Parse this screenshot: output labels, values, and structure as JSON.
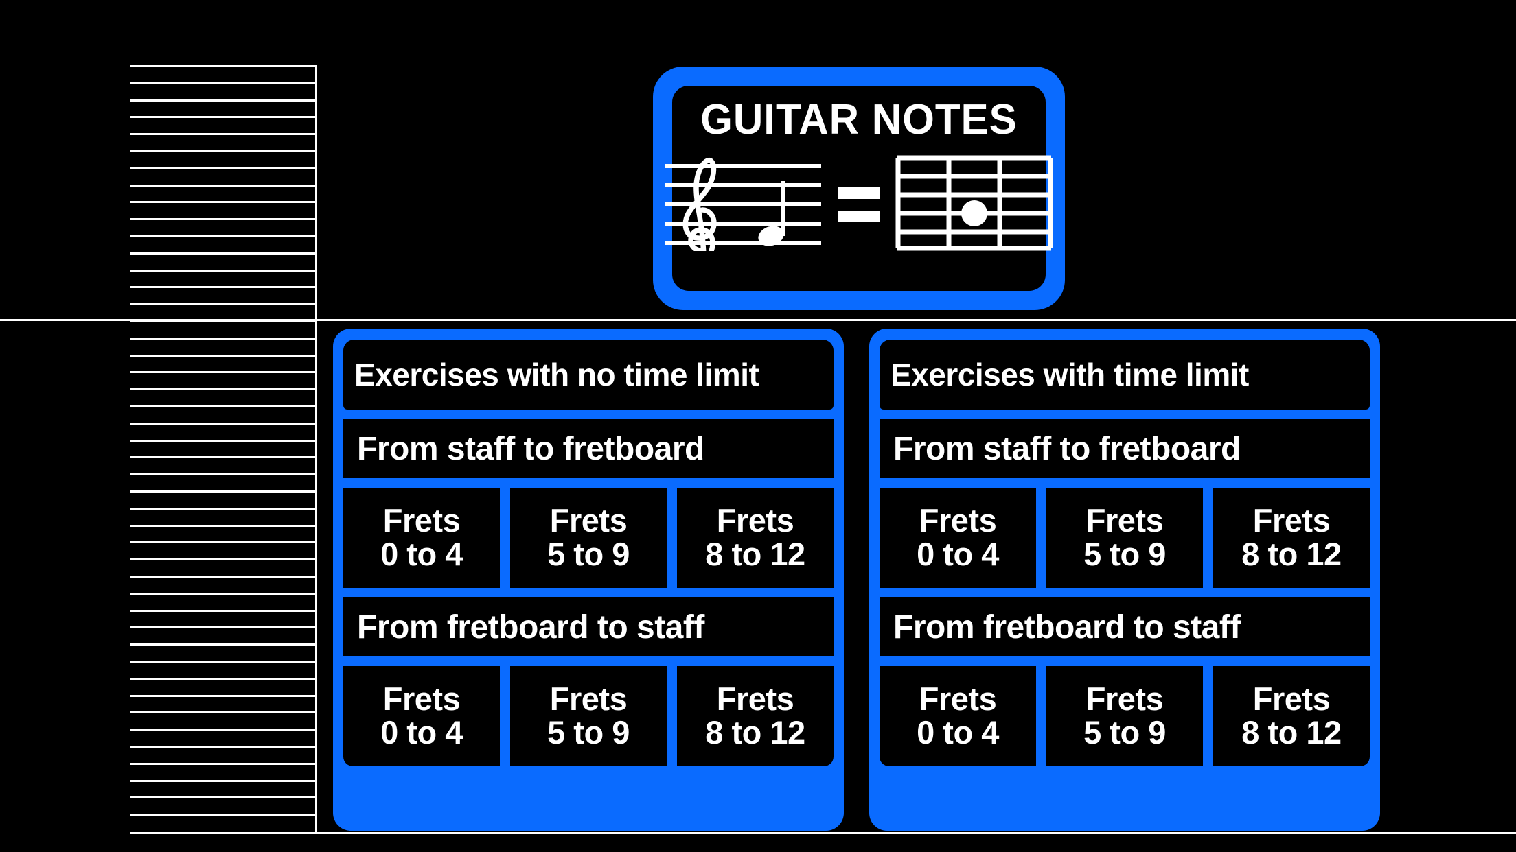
{
  "colors": {
    "accent_blue": "#0A6BFF",
    "background": "#000000",
    "text": "#FFFFFF"
  },
  "logo": {
    "title": "GUITAR NOTES",
    "staff_icon": "treble-clef-staff-icon",
    "equals_icon": "equals-icon",
    "fretboard_icon": "fretboard-diagram-icon",
    "fretboard": {
      "strings": 6,
      "frets": 3,
      "dot_string_index": 3,
      "dot_fret_index": 2
    }
  },
  "panels": [
    {
      "title": "Exercises with no time limit",
      "sections": [
        {
          "label": "From staff to fretboard",
          "buttons": [
            {
              "line1": "Frets",
              "line2": "0 to 4"
            },
            {
              "line1": "Frets",
              "line2": "5 to 9"
            },
            {
              "line1": "Frets",
              "line2": "8 to 12"
            }
          ]
        },
        {
          "label": "From fretboard to staff",
          "buttons": [
            {
              "line1": "Frets",
              "line2": "0 to 4"
            },
            {
              "line1": "Frets",
              "line2": "5 to 9"
            },
            {
              "line1": "Frets",
              "line2": "8 to 12"
            }
          ]
        }
      ]
    },
    {
      "title": "Exercises with time limit",
      "sections": [
        {
          "label": "From staff to fretboard",
          "buttons": [
            {
              "line1": "Frets",
              "line2": "0 to 4"
            },
            {
              "line1": "Frets",
              "line2": "5 to 9"
            },
            {
              "line1": "Frets",
              "line2": "8 to 12"
            }
          ]
        },
        {
          "label": "From fretboard to staff",
          "buttons": [
            {
              "line1": "Frets",
              "line2": "0 to 4"
            },
            {
              "line1": "Frets",
              "line2": "5 to 9"
            },
            {
              "line1": "Frets",
              "line2": "8 to 12"
            }
          ]
        }
      ]
    }
  ],
  "decor": {
    "ruled_lines_count": 45,
    "ruled_line_spacing": 24.8
  }
}
